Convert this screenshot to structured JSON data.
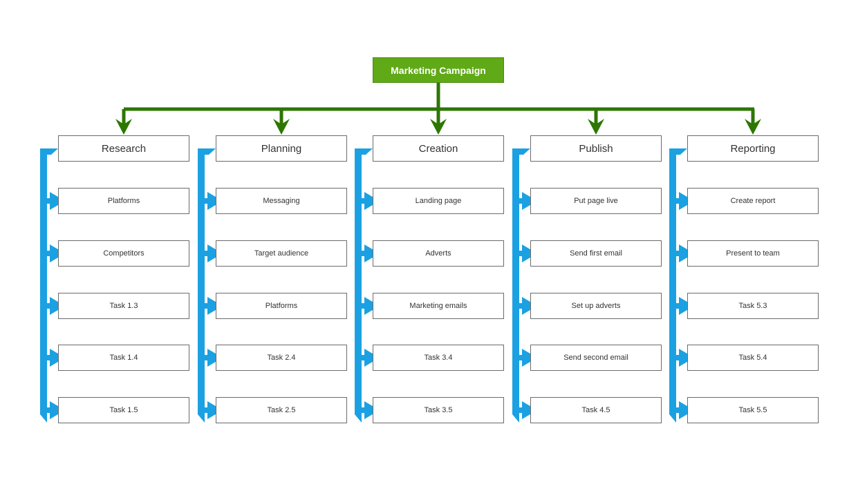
{
  "diagram": {
    "title": "Marketing Campaign",
    "colors": {
      "root_fill": "#60a917",
      "root_connector": "#2d7600",
      "task_connector": "#1ba1e2",
      "box_border": "#6b6b6b",
      "text": "#333333"
    },
    "phases": [
      {
        "label": "Research",
        "tasks": [
          "Platforms",
          "Competitors",
          "Task 1.3",
          "Task 1.4",
          "Task 1.5"
        ]
      },
      {
        "label": "Planning",
        "tasks": [
          "Messaging",
          "Target audience",
          "Platforms",
          "Task 2.4",
          "Task 2.5"
        ]
      },
      {
        "label": "Creation",
        "tasks": [
          "Landing page",
          "Adverts",
          "Marketing emails",
          "Task 3.4",
          "Task 3.5"
        ]
      },
      {
        "label": "Publish",
        "tasks": [
          "Put page live",
          "Send first email",
          "Set up adverts",
          "Send second email",
          "Task 4.5"
        ]
      },
      {
        "label": "Reporting",
        "tasks": [
          "Create report",
          "Present to team",
          "Task 5.3",
          "Task 5.4",
          "Task 5.5"
        ]
      }
    ]
  }
}
